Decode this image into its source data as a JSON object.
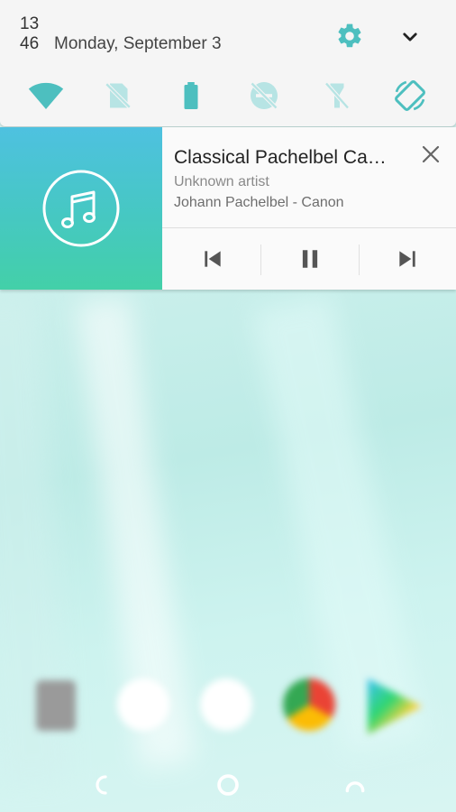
{
  "status": {
    "hour": "13",
    "minute": "46",
    "date": "Monday, September 3"
  },
  "quick_settings": {
    "accent_color": "#4dbfbf",
    "inactive_color": "#b7e4e4",
    "tiles": [
      {
        "icon": "wifi-icon",
        "active": true
      },
      {
        "icon": "no-sim-icon",
        "active": false
      },
      {
        "icon": "battery-icon",
        "active": true
      },
      {
        "icon": "do-not-disturb-off-icon",
        "active": false
      },
      {
        "icon": "flashlight-off-icon",
        "active": false
      },
      {
        "icon": "auto-rotate-icon",
        "active": true
      }
    ]
  },
  "media": {
    "title": "Classical Pachelbel Ca…",
    "artist": "Unknown artist",
    "track": "Johann Pachelbel - Canon",
    "art_gradient": [
      "#4ec1e0",
      "#43d0a8"
    ]
  }
}
